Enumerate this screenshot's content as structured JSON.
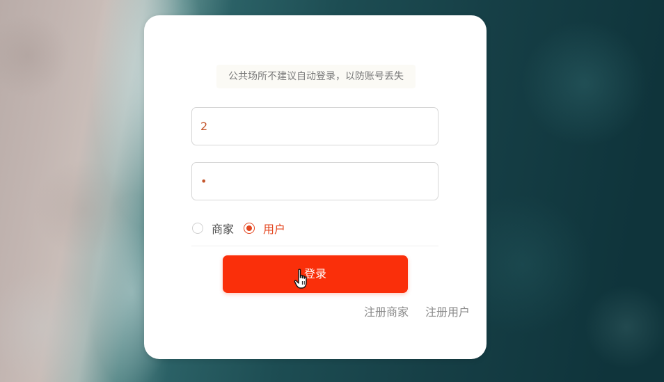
{
  "login": {
    "notice": "公共场所不建议自动登录，以防账号丢失",
    "username_value": "2",
    "password_value": "•",
    "roles": [
      {
        "label": "商家",
        "checked": false
      },
      {
        "label": "用户",
        "checked": true
      }
    ],
    "submit_label": "登录",
    "links": [
      {
        "label": "注册商家"
      },
      {
        "label": "注册用户"
      }
    ]
  },
  "colors": {
    "accent": "#fa2f0a",
    "radio_active": "#e4461f",
    "input_text": "#c4562c"
  },
  "icons": {
    "cursor": "hand-pointer-icon"
  }
}
